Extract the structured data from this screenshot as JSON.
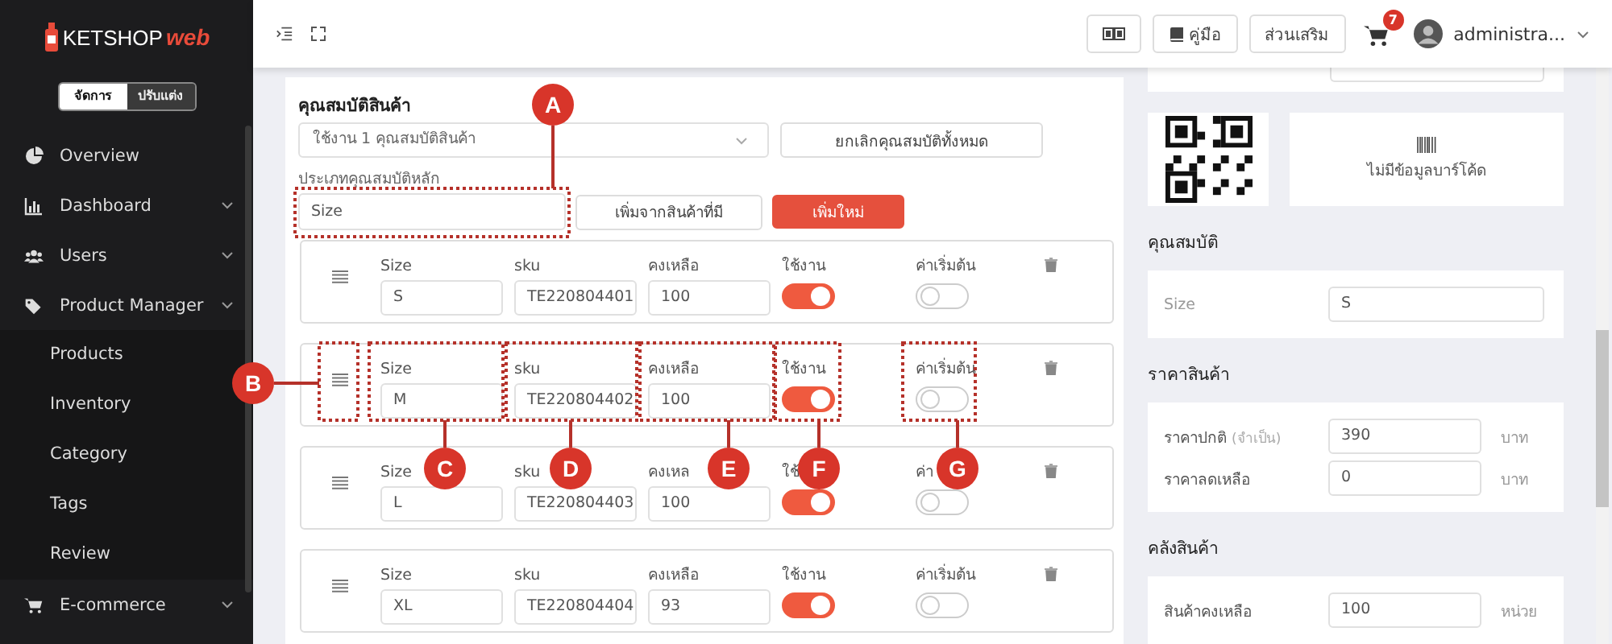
{
  "sidebar": {
    "logo": {
      "main": "KETSHOP",
      "accent": "web"
    },
    "mode_switch": [
      {
        "label": "จัดการ",
        "selected": true
      },
      {
        "label": "ปรับแต่ง",
        "selected": false
      }
    ],
    "items": [
      {
        "label": "Overview",
        "has_caret": false
      },
      {
        "label": "Dashboard",
        "has_caret": true,
        "expanded": false
      },
      {
        "label": "Users",
        "has_caret": true,
        "expanded": false
      },
      {
        "label": "Product Manager",
        "has_caret": true,
        "expanded": true,
        "children": [
          {
            "label": "Products"
          },
          {
            "label": "Inventory"
          },
          {
            "label": "Category"
          },
          {
            "label": "Tags"
          },
          {
            "label": "Review"
          }
        ]
      },
      {
        "label": "E-commerce",
        "has_caret": true,
        "expanded": false
      }
    ]
  },
  "topbar": {
    "manual_button": "คู่มือ",
    "addons_button": "ส่วนเสริม",
    "cart_badge": "7",
    "user": "administra..."
  },
  "attributes": {
    "title": "คุณสมบัติสินค้า",
    "select_value": "ใช้งาน 1 คุณสมบัติสินค้า",
    "clear_button": "ยกเลิกคุณสมบัติทั้งหมด",
    "main_type_label": "ประเภทคุณสมบัติหลัก",
    "main_type_value": "Size",
    "add_existing_button": "เพิ่มจากสินค้าที่มี",
    "add_new_button": "เพิ่มใหม่",
    "variants": [
      {
        "labels": [
          "Size",
          "sku",
          "คงเหลือ",
          "ใช้งาน",
          "ค่าเริ่มต้น"
        ],
        "size": "S",
        "sku": "TE220804401",
        "stock": "100",
        "active": true,
        "default": false
      },
      {
        "labels": [
          "Size",
          "sku",
          "คงเหลือ",
          "ใช้งาน",
          "ค่าเริ่มต้น"
        ],
        "size": "M",
        "sku": "TE220804402",
        "stock": "100",
        "active": true,
        "default": false
      },
      {
        "labels": [
          "Size",
          "sku",
          "คงเหล",
          "ใช้",
          "ค่า"
        ],
        "size": "L",
        "sku": "TE220804403",
        "stock": "100",
        "active": true,
        "default": false
      },
      {
        "labels": [
          "Size",
          "sku",
          "คงเหลือ",
          "ใช้งาน",
          "ค่าเริ่มต้น"
        ],
        "size": "XL",
        "sku": "TE220804404",
        "stock": "93",
        "active": true,
        "default": false
      }
    ]
  },
  "right_panel": {
    "barcode_empty": "ไม่มีข้อมูลบาร์โค้ด",
    "properties": {
      "title": "คุณสมบัติ",
      "label": "Size",
      "value": "S"
    },
    "price": {
      "title": "ราคาสินค้า",
      "rows": [
        {
          "label": "ราคาปกติ",
          "note": "(จำเป็น)",
          "value": "390",
          "unit": "บาท"
        },
        {
          "label": "ราคาลดเหลือ",
          "value": "0",
          "unit": "บาท"
        }
      ]
    },
    "stock": {
      "title": "คลังสินค้า",
      "rows": [
        {
          "label": "สินค้าคงเหลือ",
          "value": "100",
          "unit": "หน่วย"
        }
      ]
    }
  },
  "callouts": [
    {
      "letter": "A"
    },
    {
      "letter": "B"
    },
    {
      "letter": "C"
    },
    {
      "letter": "D"
    },
    {
      "letter": "E"
    },
    {
      "letter": "F"
    },
    {
      "letter": "G"
    }
  ]
}
